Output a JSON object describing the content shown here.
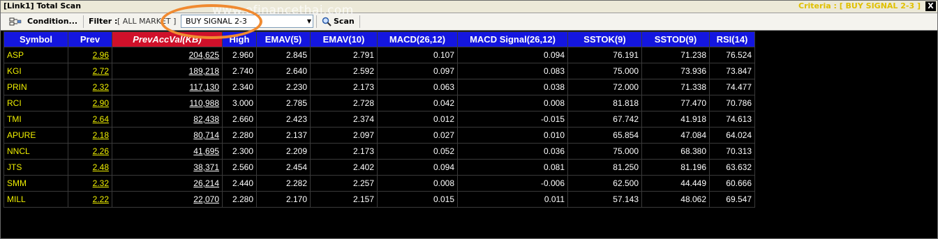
{
  "window": {
    "title": "[Link1] Total Scan",
    "criteria": "Criteria : [ BUY SIGNAL 2-3 ]",
    "close_label": "X"
  },
  "toolbar": {
    "condition_label": "Condition...",
    "filter_label": "Filter :",
    "filter_value": "[ ALL MARKET ]",
    "signal_value": "BUY SIGNAL 2-3",
    "scan_label": "Scan"
  },
  "watermark": "www.efinancethai.com",
  "colors": {
    "header_bg": "#1416e0",
    "highlight_header_bg": "#d0102a",
    "symbol_text": "#f0f000",
    "ring": "#f08a30"
  },
  "table": {
    "columns": [
      "Symbol",
      "Prev",
      "PrevAccVal(KB)",
      "High",
      "EMAV(5)",
      "EMAV(10)",
      "MACD(26,12)",
      "MACD Signal(26,12)",
      "SSTOK(9)",
      "SSTOD(9)",
      "RSI(14)"
    ],
    "rows": [
      [
        "ASP",
        "2.96",
        "204,625",
        "2.960",
        "2.845",
        "2.791",
        "0.107",
        "0.094",
        "76.191",
        "71.238",
        "76.524"
      ],
      [
        "KGI",
        "2.72",
        "189,218",
        "2.740",
        "2.640",
        "2.592",
        "0.097",
        "0.083",
        "75.000",
        "73.936",
        "73.847"
      ],
      [
        "PRIN",
        "2.32",
        "117,130",
        "2.340",
        "2.230",
        "2.173",
        "0.063",
        "0.038",
        "72.000",
        "71.338",
        "74.477"
      ],
      [
        "RCI",
        "2.90",
        "110,988",
        "3.000",
        "2.785",
        "2.728",
        "0.042",
        "0.008",
        "81.818",
        "77.470",
        "70.786"
      ],
      [
        "TMI",
        "2.64",
        "82,438",
        "2.660",
        "2.423",
        "2.374",
        "0.012",
        "-0.015",
        "67.742",
        "41.918",
        "74.613"
      ],
      [
        "APURE",
        "2.18",
        "80,714",
        "2.280",
        "2.137",
        "2.097",
        "0.027",
        "0.010",
        "65.854",
        "47.084",
        "64.024"
      ],
      [
        "NNCL",
        "2.26",
        "41,695",
        "2.300",
        "2.209",
        "2.173",
        "0.052",
        "0.036",
        "75.000",
        "68.380",
        "70.313"
      ],
      [
        "JTS",
        "2.48",
        "38,371",
        "2.560",
        "2.454",
        "2.402",
        "0.094",
        "0.081",
        "81.250",
        "81.196",
        "63.632"
      ],
      [
        "SMM",
        "2.32",
        "26,214",
        "2.440",
        "2.282",
        "2.257",
        "0.008",
        "-0.006",
        "62.500",
        "44.449",
        "60.666"
      ],
      [
        "MILL",
        "2.22",
        "22,070",
        "2.280",
        "2.170",
        "2.157",
        "0.015",
        "0.011",
        "57.143",
        "48.062",
        "69.547"
      ]
    ]
  }
}
